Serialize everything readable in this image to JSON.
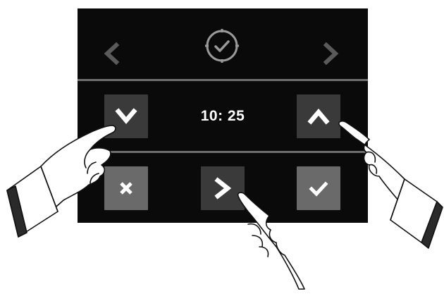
{
  "header": {
    "prev_icon": "chevron-left-icon",
    "clock_icon": "clock-check-icon",
    "next_icon": "chevron-right-icon"
  },
  "time": {
    "value": "10: 25",
    "decrease_icon": "chevron-down-icon",
    "increase_icon": "chevron-up-icon"
  },
  "actions": {
    "cancel_icon": "close-icon",
    "next_icon": "chevron-right-icon",
    "confirm_icon": "checkmark-icon"
  },
  "colors": {
    "panel": "#0a0a0a",
    "divider": "#6e6e6e",
    "inactive_arrow": "#5a5a5a",
    "icon_outline": "#9a9a9a",
    "button_dark": "#3a3a3a",
    "button_grey": "#6a6a6a",
    "glyph": "#ffffff"
  }
}
